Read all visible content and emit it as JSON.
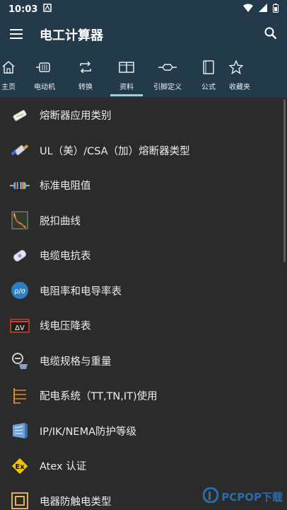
{
  "status": {
    "time": "10:03"
  },
  "toolbar": {
    "title": "电工计算器"
  },
  "tabs": [
    {
      "label": "主页",
      "icon": "home-icon"
    },
    {
      "label": "电动机",
      "icon": "motor-icon"
    },
    {
      "label": "转换",
      "icon": "convert-icon"
    },
    {
      "label": "资料",
      "icon": "book-open-icon",
      "active": true
    },
    {
      "label": "引脚定义",
      "icon": "pin-icon"
    },
    {
      "label": "公式",
      "icon": "book-icon"
    },
    {
      "label": "收藏夹",
      "icon": "star-icon"
    }
  ],
  "items": [
    {
      "label": "熔断器应用类别",
      "icon": "fuse-icon"
    },
    {
      "label": "UL（美）/CSA（加）熔断器类型",
      "icon": "ul-fuse-icon"
    },
    {
      "label": "标准电阻值",
      "icon": "resistor-icon"
    },
    {
      "label": "脱扣曲线",
      "icon": "trip-curve-icon"
    },
    {
      "label": "电缆电抗表",
      "icon": "cable-reactance-icon"
    },
    {
      "label": "电阻率和电导率表",
      "icon": "resistivity-icon"
    },
    {
      "label": "线电压降表",
      "icon": "voltage-drop-icon"
    },
    {
      "label": "电缆规格与重量",
      "icon": "cable-weight-icon"
    },
    {
      "label": "配电系统（TT,TN,IT)使用",
      "icon": "distribution-icon"
    },
    {
      "label": "IP/IK/NEMA防护等级",
      "icon": "protection-icon"
    },
    {
      "label": "Atex 认证",
      "icon": "atex-icon"
    },
    {
      "label": "电器防触电类型",
      "icon": "shock-class-icon"
    }
  ],
  "icon_text": {
    "resistivity": "ρ/σ",
    "voltage_drop": "ΔV",
    "atex": "Ex"
  },
  "watermark": "PCPOP下载"
}
